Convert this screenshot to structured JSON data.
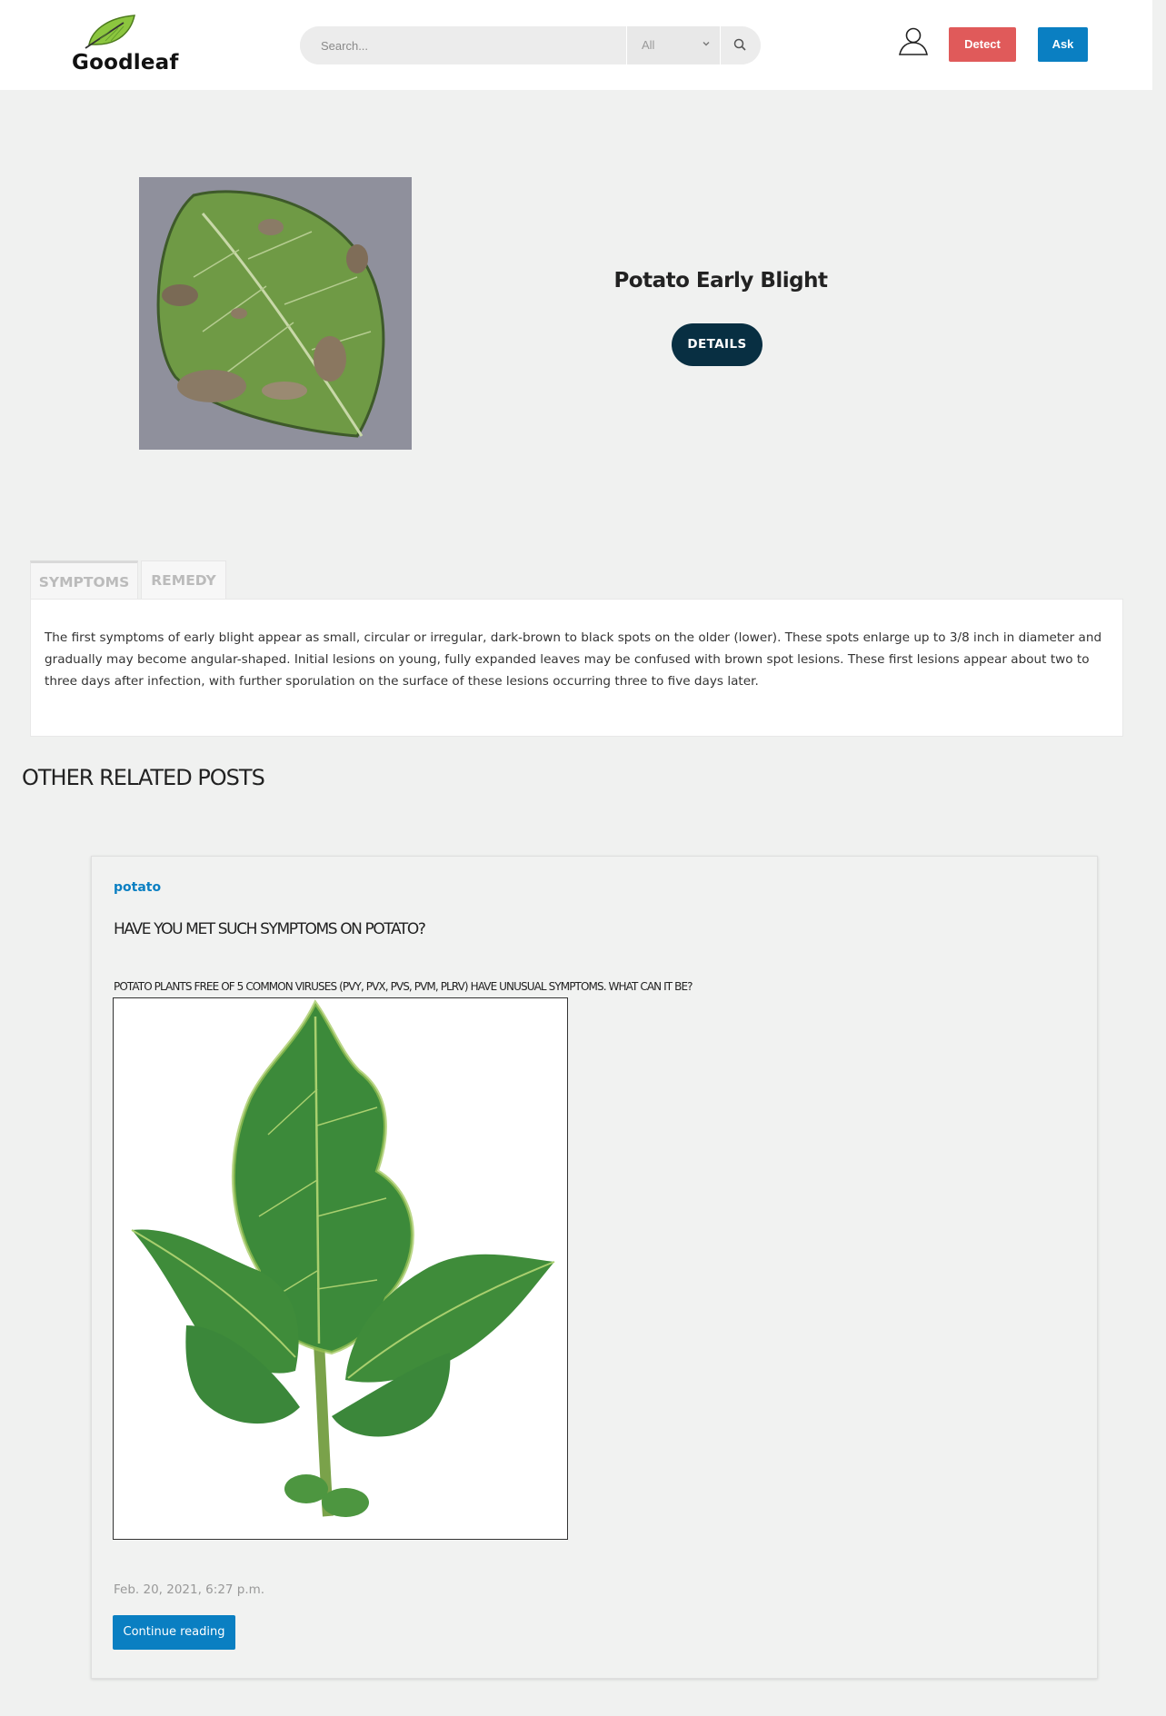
{
  "header": {
    "logo_text": "Goodleaf",
    "search": {
      "placeholder": "Search...",
      "category_value": "All"
    },
    "detect_label": "Detect",
    "ask_label": "Ask"
  },
  "hero": {
    "title": "Potato Early Blight",
    "details_label": "DETAILS"
  },
  "tabs": [
    {
      "label": "SYMPTOMS",
      "active": true
    },
    {
      "label": "REMEDY",
      "active": false
    }
  ],
  "symptoms_text": "The first symptoms of early blight appear as small, circular or irregular, dark-brown to black spots on the older (lower). These spots enlarge up to 3/8 inch in diameter and gradually may become angular-shaped. Initial lesions on young, fully expanded leaves may be confused with brown spot lesions. These first lesions appear about two to three days after infection, with further sporulation on the surface of these lesions occurring three to five days later.",
  "related": {
    "heading": "OTHER RELATED POSTS",
    "posts": [
      {
        "category": "potato",
        "title": "HAVE YOU MET SUCH SYMPTOMS ON POTATO?",
        "subtitle": "POTATO PLANTS FREE OF 5 COMMON VIRUSES (PVY, PVX, PVS, PVM, PLRV) HAVE UNUSUAL SYMPTOMS. WHAT CAN IT BE?",
        "date": "Feb. 20, 2021, 6:27 p.m.",
        "continue_label": "Continue reading"
      }
    ]
  },
  "colors": {
    "detect": "#e05a5a",
    "ask": "#0a7fc2",
    "details": "#082f42",
    "category": "#0a7fc2",
    "page_bg": "#f0f1f0"
  }
}
